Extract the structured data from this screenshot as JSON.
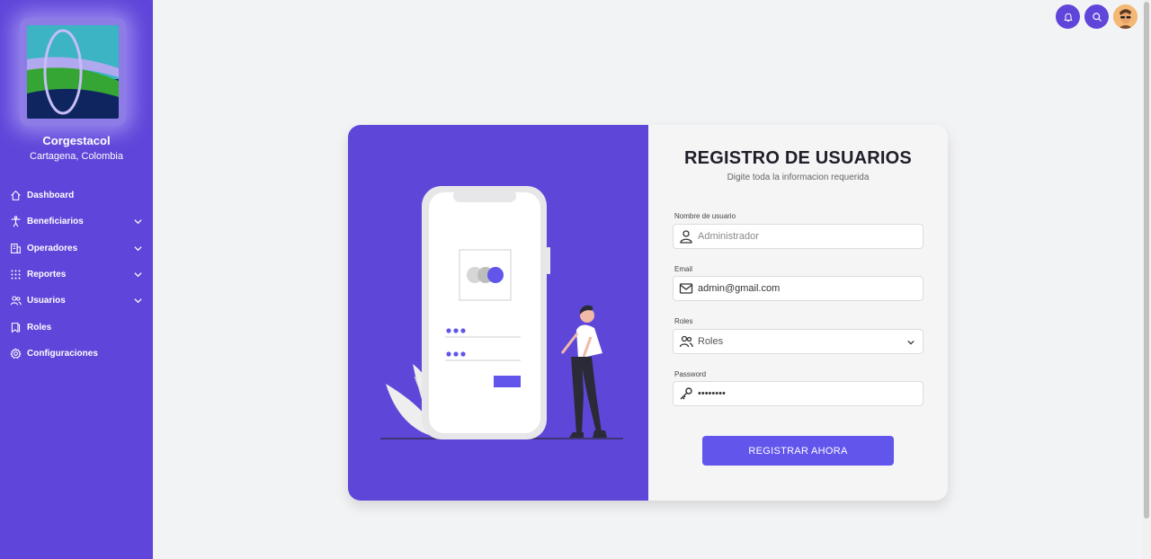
{
  "brand": {
    "name": "Corgestacol",
    "location": "Cartagena, Colombia"
  },
  "nav": [
    {
      "label": "Dashboard",
      "icon": "home-icon",
      "expandable": false
    },
    {
      "label": "Beneficiarios",
      "icon": "person-icon",
      "expandable": true
    },
    {
      "label": "Operadores",
      "icon": "building-icon",
      "expandable": true
    },
    {
      "label": "Reportes",
      "icon": "grid-dots-icon",
      "expandable": true
    },
    {
      "label": "Usuarios",
      "icon": "users-icon",
      "expandable": true
    },
    {
      "label": "Roles",
      "icon": "bookmark-icon",
      "expandable": false
    },
    {
      "label": "Configuraciones",
      "icon": "gear-icon",
      "expandable": false
    }
  ],
  "topbar": {
    "icons": [
      "bell-icon",
      "search-icon",
      "avatar"
    ]
  },
  "form": {
    "title": "REGISTRO DE USUARIOS",
    "subtitle": "Digite toda la informacion requerida",
    "username": {
      "label": "Nombre de usuario",
      "placeholder": "Administrador",
      "value": ""
    },
    "email": {
      "label": "Email",
      "placeholder": "admin@gmail.com",
      "value": "admin@gmail.com"
    },
    "roles": {
      "label": "Roles",
      "selected": "Roles"
    },
    "password": {
      "label": "Password",
      "value": "12345678"
    },
    "submit_label": "REGISTRAR AHORA"
  },
  "colors": {
    "primary": "#5f45d9",
    "card_panel": "#5e47d8",
    "button": "#6155ec",
    "background": "#f2f3f5"
  }
}
